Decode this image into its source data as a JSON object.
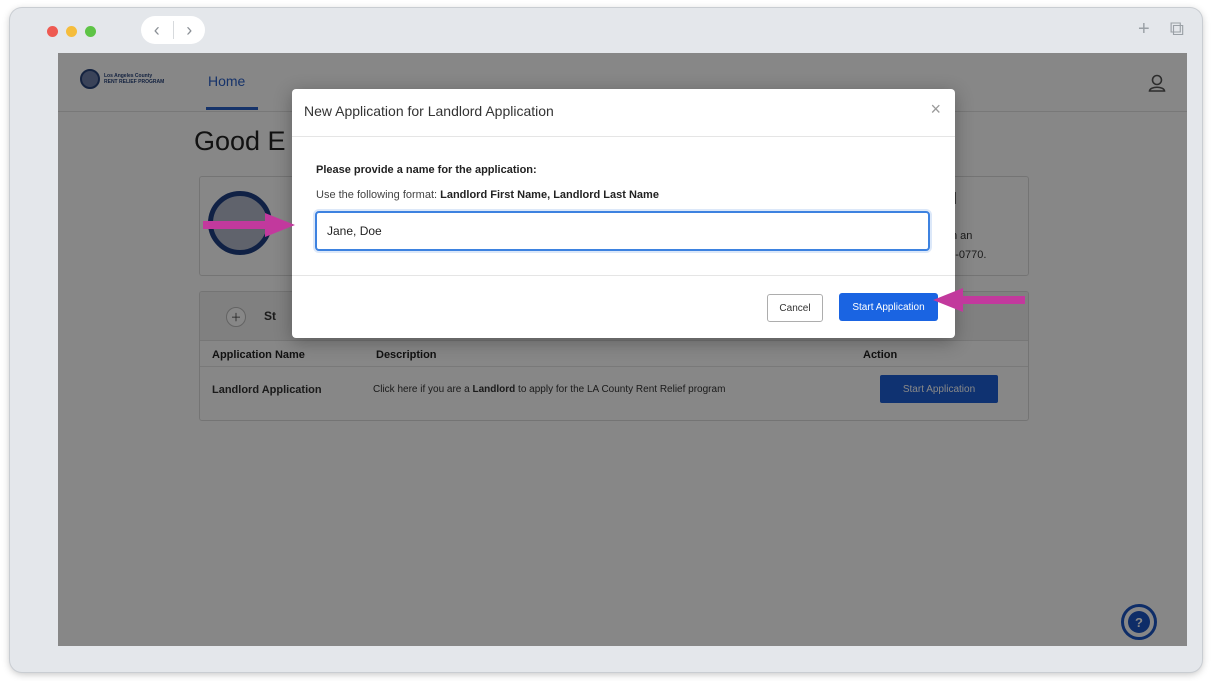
{
  "app": {
    "logo_line1": "Los Angeles County",
    "logo_line2": "RENT RELIEF PROGRAM",
    "nav_home": "Home",
    "greeting": "Good E",
    "card1": {
      "heading_fragment": "tal",
      "line1_fragment": "l in an",
      "line2_fragment": "49-0770."
    },
    "card2": {
      "title_fragment": "St",
      "columns": [
        "Application Name",
        "Description",
        "Action"
      ],
      "row": {
        "name": "Landlord Application",
        "desc_before": "Click here if you are a ",
        "desc_bold": "Landlord",
        "desc_after": " to apply for the LA County Rent Relief program",
        "action_label": "Start Application"
      }
    },
    "help_label": "?"
  },
  "modal": {
    "title": "New Application for Landlord Application",
    "close": "×",
    "prompt": "Please provide a name for the application:",
    "format_prefix": "Use the following format: ",
    "format_value": "Landlord First Name, Landlord Last Name",
    "name_value": "Jane, Doe",
    "cancel_label": "Cancel",
    "start_label": "Start Application"
  },
  "browser": {
    "back": "‹",
    "forward": "›",
    "new_tab": "+",
    "tabs_icon": "⧉"
  },
  "colors": {
    "accent": "#1a64e2",
    "annotation_arrow": "#c2399d"
  }
}
